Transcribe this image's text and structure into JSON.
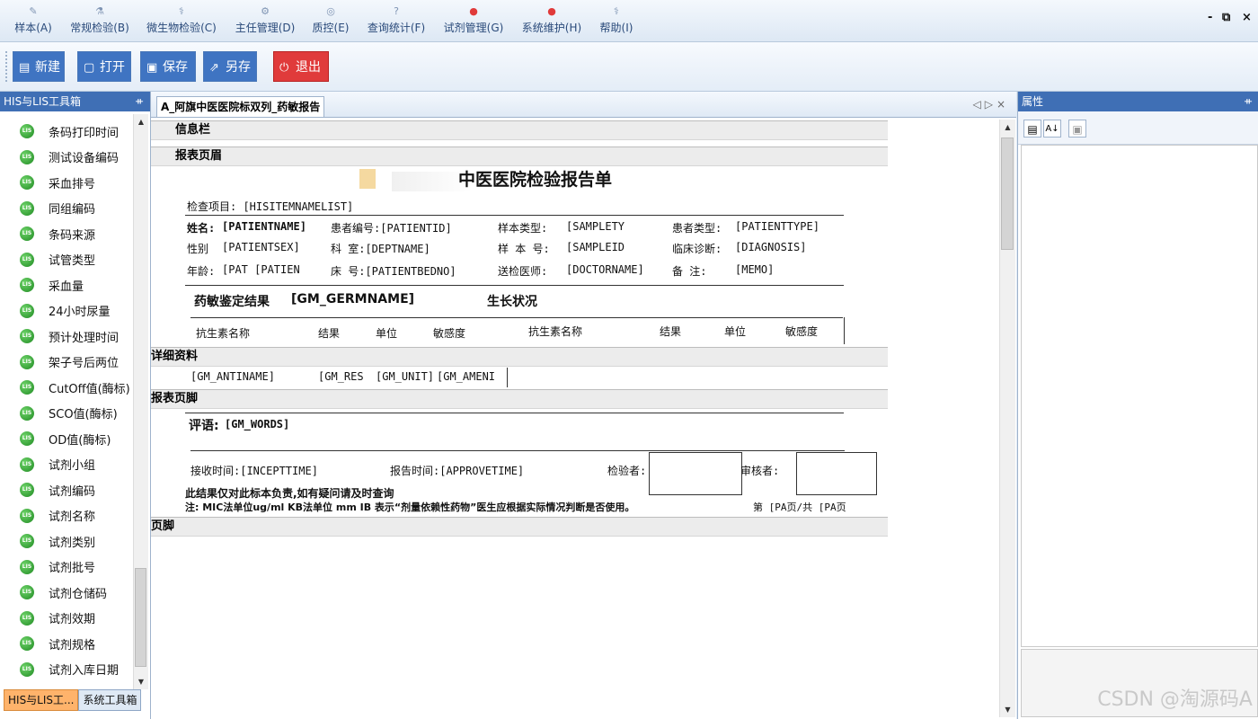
{
  "menu": {
    "items": [
      {
        "label": "样本(A)",
        "icon": "✎"
      },
      {
        "label": "常规检验(B)",
        "icon": "⚗"
      },
      {
        "label": "微生物检验(C)",
        "icon": "⚕"
      },
      {
        "label": "主任管理(D)",
        "icon": "⚙"
      },
      {
        "label": "质控(E)",
        "icon": "◎"
      },
      {
        "label": "查询统计(F)",
        "icon": "?"
      },
      {
        "label": "试剂管理(G)",
        "icon": "●"
      },
      {
        "label": "系统维护(H)",
        "icon": "●"
      },
      {
        "label": "帮助(I)",
        "icon": "⚕"
      }
    ],
    "window_controls": {
      "minimize": "-",
      "restore": "⧉",
      "close": "×"
    }
  },
  "toolbar": {
    "new_label": "新建",
    "open_label": "打开",
    "save_label": "保存",
    "saveas_label": "另存",
    "exit_label": "退出"
  },
  "left_panel": {
    "title": "HIS与LIS工具箱",
    "pin": "ᚑ",
    "items": [
      "条码打印时间",
      "测试设备编码",
      "采血排号",
      "同组编码",
      "条码来源",
      "试管类型",
      "采血量",
      "24小时尿量",
      "预计处理时间",
      "架子号后两位",
      "CutOff值(酶标)",
      "SCO值(酶标)",
      "OD值(酶标)",
      "试剂小组",
      "试剂编码",
      "试剂名称",
      "试剂类别",
      "试剂批号",
      "试剂仓储码",
      "试剂效期",
      "试剂规格",
      "试剂入库日期"
    ],
    "item_icon_text": "LIS",
    "bottom_tabs": [
      "HIS与LIS工...",
      "系统工具箱"
    ]
  },
  "document": {
    "tab_title": "A_阿旗中医医院标双列_药敏报告",
    "tab_nav": "◁▷×"
  },
  "report": {
    "bands": {
      "info": "信息栏",
      "header": "报表页眉",
      "detail": "详细资料",
      "footer": "报表页脚",
      "page_footer": "页脚"
    },
    "title": "中医医院检验报告单",
    "exam_item": "检查项目: [HISITEMNAMELIST]",
    "patient_rows": [
      [
        "姓名:",
        "[PATIENTNAME]",
        "患者编号:[PATIENTID]",
        "样本类型:",
        "[SAMPLETY",
        "患者类型:",
        "[PATIENTTYPE]"
      ],
      [
        "性别",
        "[PATIENTSEX]",
        "科    室:[DEPTNAME]",
        "样 本 号:",
        "[SAMPLEID",
        "临床诊断:",
        "[DIAGNOSIS]"
      ],
      [
        "年龄:",
        "[PAT [PATIEN",
        "床    号:[PATIENTBEDNO]",
        "送检医师:",
        "[DOCTORNAME]",
        "备    注:",
        "[MEMO]"
      ]
    ],
    "result_title": "药敏鉴定结果",
    "germ_name": "[GM_GERMNAME]",
    "growth": "生长状况",
    "col_headers": [
      "抗生素名称",
      "结果",
      "单位",
      "敏感度",
      "抗生素名称",
      "结果",
      "单位",
      "敏感度"
    ],
    "detail_fields": [
      "[GM_ANTINAME]",
      "[GM_RES",
      "[GM_UNIT]",
      "[GM_AMENI"
    ],
    "comment_label": "评语:",
    "comment_field": "[GM_WORDS]",
    "receive_time": "接收时间:[INCEPTTIME]",
    "report_time": "报告时间:[APPROVETIME]",
    "inspector": "检验者:",
    "reviewer": "审核者:",
    "disclaimer": "此结果仅对此标本负责,如有疑问请及时查询",
    "note": "注: MIC法单位ug/ml  KB法单位 mm  IB 表示“剂量依赖性药物”医生应根据实际情况判断是否使用。",
    "page_info": "第 [PA页/共 [PA页"
  },
  "right_panel": {
    "title": "属性",
    "pin": "ᚑ",
    "sort_category": "▤",
    "sort_alpha": "A↓",
    "property_pages": "▣"
  },
  "watermark": "CSDN @淘源码A"
}
